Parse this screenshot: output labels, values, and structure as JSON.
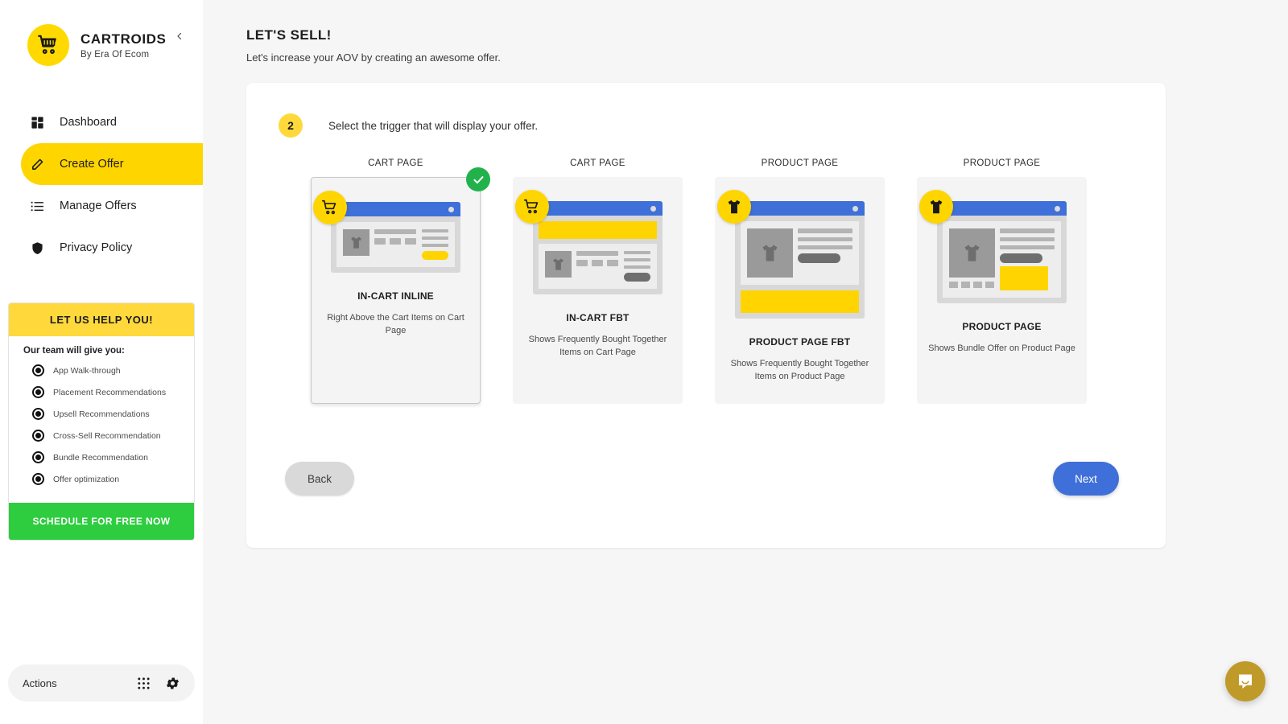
{
  "brand": {
    "title": "CARTROIDS",
    "subtitle": "By Era Of Ecom",
    "logo_icon": "shopping-cart-icon",
    "collapse_icon": "chevron-left-icon"
  },
  "sidebar": {
    "items": [
      {
        "label": "Dashboard",
        "icon": "dashboard-grid-icon",
        "active": false
      },
      {
        "label": "Create Offer",
        "icon": "pencil-icon",
        "active": true
      },
      {
        "label": "Manage Offers",
        "icon": "list-icon",
        "active": false
      },
      {
        "label": "Privacy Policy",
        "icon": "shield-icon",
        "active": false
      }
    ],
    "help": {
      "heading": "LET US HELP YOU!",
      "subheading": "Our team will give you:",
      "options": [
        "App Walk-through",
        "Placement Recommendations",
        "Upsell Recommendations",
        "Cross-Sell Recommendation",
        "Bundle Recommendation",
        "Offer optimization"
      ],
      "cta": "SCHEDULE FOR FREE NOW"
    },
    "actions": {
      "label": "Actions",
      "grid_icon": "apps-grid-icon",
      "gear_icon": "gear-icon"
    }
  },
  "header": {
    "title": "LET'S SELL!",
    "subtitle": "Let's increase your AOV by creating an awesome offer."
  },
  "step": {
    "number": "2",
    "instruction": "Select the trigger that will display your offer."
  },
  "triggers": [
    {
      "caption": "CART PAGE",
      "title": "IN-CART INLINE",
      "description": "Right Above the Cart Items on Cart Page",
      "badge_icon": "shopping-cart-icon",
      "selected": true
    },
    {
      "caption": "CART PAGE",
      "title": "IN-CART FBT",
      "description": "Shows Frequently Bought Together Items on Cart Page",
      "badge_icon": "shopping-cart-icon",
      "selected": false
    },
    {
      "caption": "PRODUCT PAGE",
      "title": "PRODUCT PAGE FBT",
      "description": "Shows Frequently Bought Together Items on Product Page",
      "badge_icon": "tshirt-icon",
      "selected": false
    },
    {
      "caption": "PRODUCT PAGE",
      "title": "PRODUCT PAGE",
      "description": "Shows Bundle Offer on Product Page",
      "badge_icon": "tshirt-icon",
      "selected": false
    }
  ],
  "footer": {
    "back_label": "Back",
    "next_label": "Next"
  },
  "chat": {
    "icon": "chat-bubble-icon"
  },
  "colors": {
    "brand_yellow": "#ffd500",
    "accent_blue": "#3f6fd8",
    "success_green": "#22b24c",
    "cta_green": "#2ecc3f",
    "chat_gold": "#c09a28"
  }
}
